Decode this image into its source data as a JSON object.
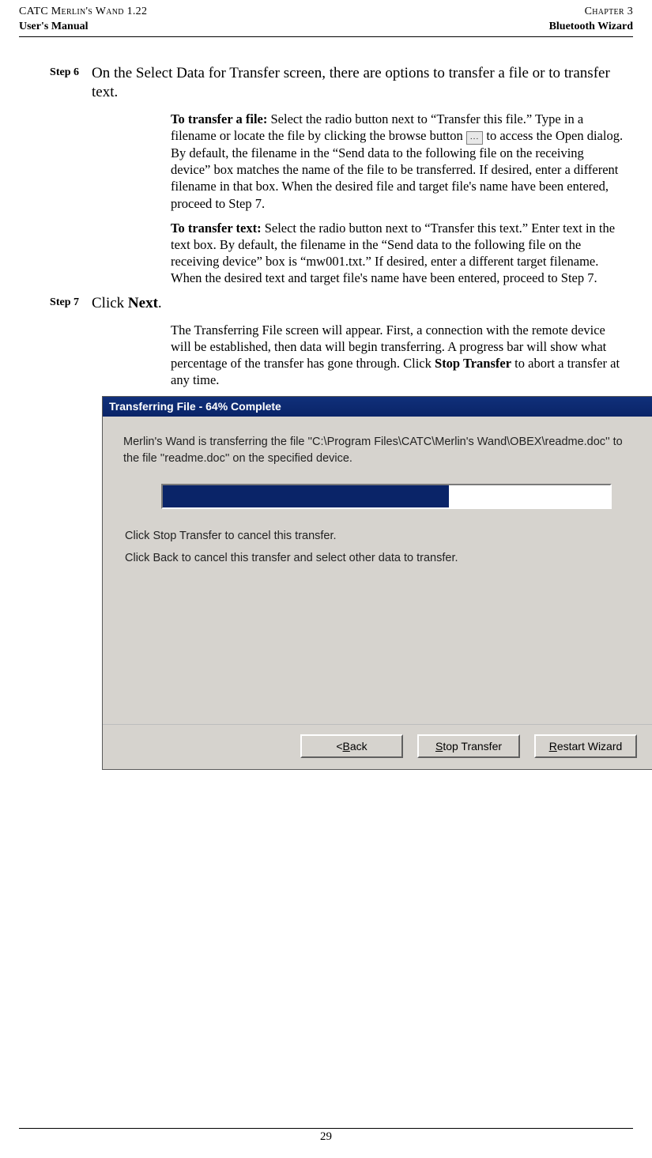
{
  "header": {
    "top_left": "CATC Merlin's Wand 1.22",
    "top_right": "Chapter 3",
    "bottom_left": "User's Manual",
    "bottom_right": "Bluetooth Wizard"
  },
  "steps": {
    "s6_label": "Step 6",
    "s6_intro": "On the Select Data for Transfer screen, there are options to transfer a file or to transfer text.",
    "file_lead": "To transfer a file:",
    "file_text_a": " Select the radio button next to “Transfer this file.” Type in a filename or locate the file by clicking the browse button ",
    "browse_label": "...",
    "file_text_b": " to access the Open dialog. By default, the filename in the “Send data to the following file on the receiving device” box matches the name of the file to be transferred. If desired, enter a different filename in that box. When the desired file and target file's name have been entered, proceed to Step 7.",
    "text_lead": "To transfer text:",
    "text_body": " Select the radio button next to “Transfer this text.” Enter text in the text box. By default, the filename in the “Send data to the following file on the receiving device” box is “mw001.txt.” If desired, enter a different target filename. When the desired text and target file's name have been entered, proceed to Step 7.",
    "s7_label": "Step 7",
    "s7_intro_a": "Click ",
    "s7_intro_b": "Next",
    "s7_intro_c": ".",
    "s7_body_a": "The Transferring File screen will appear. First, a connection with the remote device will be established, then data will begin transferring. A progress bar will show what percentage of the transfer has gone through. Click ",
    "s7_body_b": "Stop Transfer",
    "s7_body_c": " to abort a transfer at any time."
  },
  "dialog": {
    "title": "Transferring File - 64% Complete",
    "desc": "Merlin's Wand is transferring the file ''C:\\Program Files\\CATC\\Merlin's Wand\\OBEX\\readme.doc'' to the file ''readme.doc'' on the specified device.",
    "progress_percent": 64,
    "line1": "Click Stop Transfer to cancel this transfer.",
    "line2": "Click Back to cancel this transfer and select other data to transfer.",
    "back": "< Back",
    "stop": "Stop Transfer",
    "restart": "Restart Wizard"
  },
  "page_number": "29"
}
